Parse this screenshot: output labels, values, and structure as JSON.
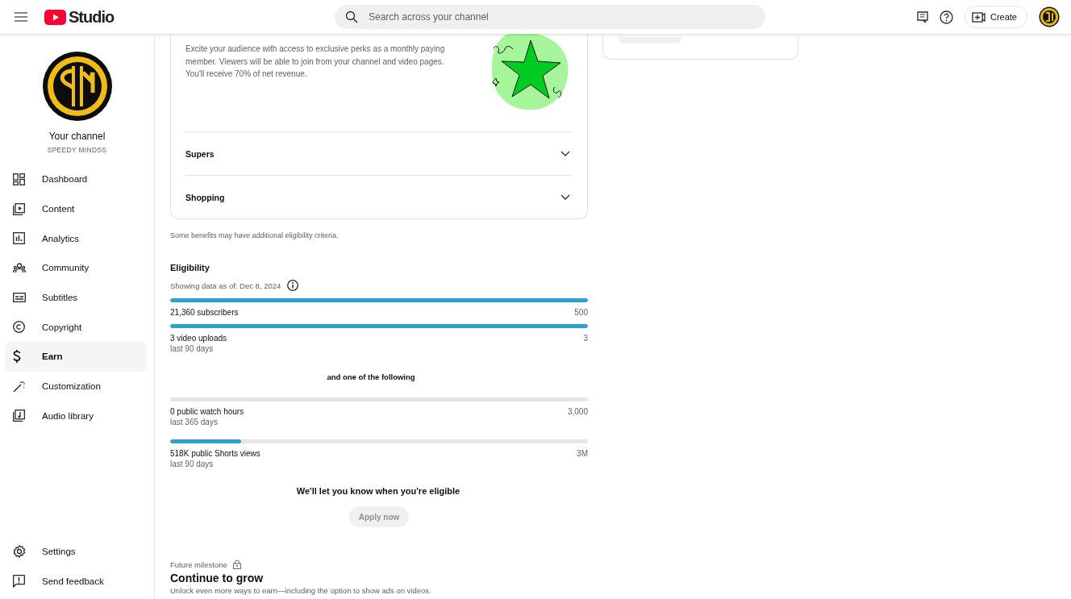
{
  "header": {
    "logo_text": "Studio",
    "search": {
      "placeholder": "Search across your channel"
    },
    "create_button": "Create"
  },
  "sidebar": {
    "channel": {
      "title": "Your channel",
      "name": "SPEEDY MINDSS"
    },
    "items": [
      {
        "label": "Dashboard",
        "selected": false
      },
      {
        "label": "Content",
        "selected": false
      },
      {
        "label": "Analytics",
        "selected": false
      },
      {
        "label": "Community",
        "selected": false
      },
      {
        "label": "Subtitles",
        "selected": false
      },
      {
        "label": "Copyright",
        "selected": false
      },
      {
        "label": "Earn",
        "selected": true
      },
      {
        "label": "Customization",
        "selected": false
      },
      {
        "label": "Audio library",
        "selected": false
      }
    ],
    "footer_items": [
      {
        "label": "Settings"
      },
      {
        "label": "Send feedback"
      }
    ]
  },
  "benefits_card": {
    "description": "Excite your audience with access to exclusive perks as a monthly paying member. Viewers will be able to join from your channel and video pages. You'll receive 70% of net revenue.",
    "sections": [
      {
        "label": "Supers",
        "expanded": false
      },
      {
        "label": "Shopping",
        "expanded": false
      }
    ]
  },
  "note": "Some benefits may have additional eligibility criteria.",
  "eligibility": {
    "title": "Eligibility",
    "as_of": "Showing data as of: Dec 8, 2024",
    "required": [
      {
        "label": "21,360 subscribers",
        "target": "500",
        "level": 1
      },
      {
        "label": "3 video uploads",
        "sublabel": "last 90 days",
        "target": "3",
        "level": 1
      }
    ],
    "separator": "and one of the following",
    "alternatives": [
      {
        "label": "0 public watch hours",
        "sublabel": "last 365 days",
        "target": "3,000",
        "level": 0
      },
      {
        "label": "518K public Shorts views",
        "sublabel": "last 90 days",
        "target": "3M",
        "level": 0.17
      }
    ],
    "status": "We'll let you know when you're eligible",
    "apply_button": {
      "label": "Apply now",
      "disabled": true
    }
  },
  "milestone": {
    "label": "Future milestone",
    "title": "Continue to grow",
    "description": "Unlock even more ways to earn—including the option to show ads on videos."
  }
}
